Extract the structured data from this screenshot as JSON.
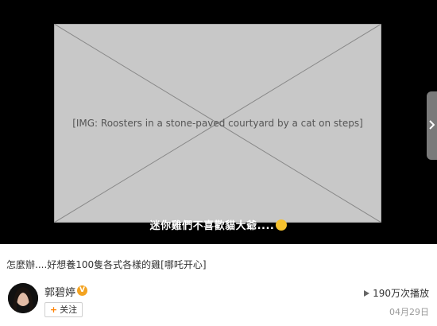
{
  "video": {
    "subtitle_text": "迷你雞們不喜歡貓大爺....",
    "side_handle_icon": "chevron-right-icon"
  },
  "post": {
    "caption": "怎麼辦....好想養100隻各式各樣的雞[哪吒开心]",
    "author": "郭碧婷",
    "verified_icon": "verified-badge-icon",
    "follow_label": "关注",
    "play_count": "190万次播放",
    "date": "04月29日"
  },
  "colors": {
    "verified": "#f3a321",
    "follow_plus": "#ff8200",
    "player_bg": "#000000"
  }
}
